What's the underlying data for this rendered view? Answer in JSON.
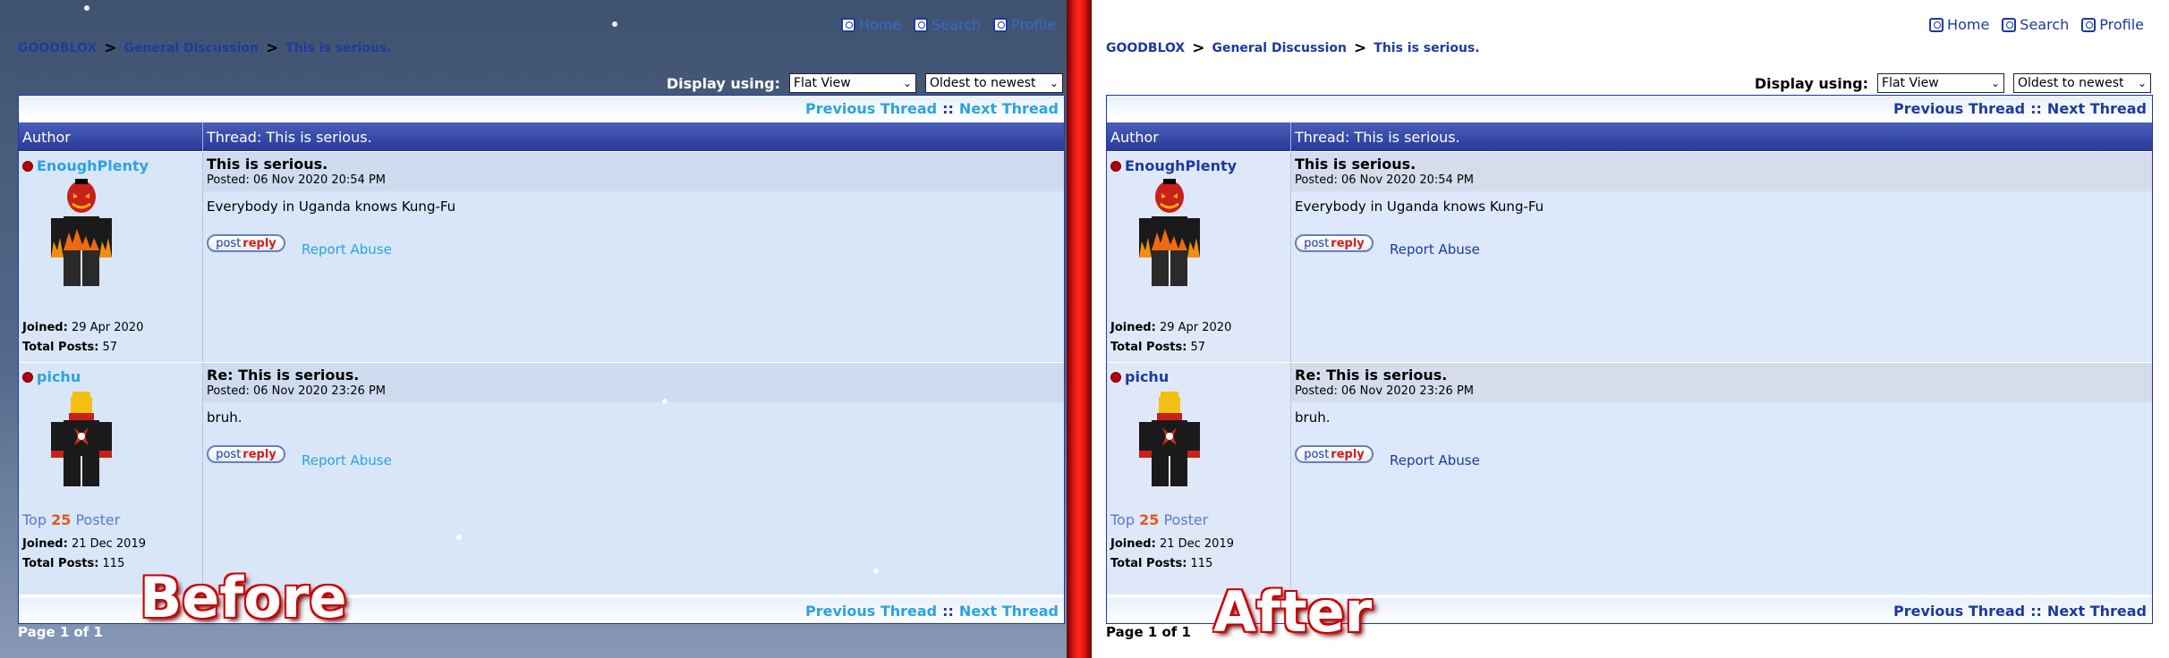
{
  "toplinks": {
    "home": "Home",
    "search": "Search",
    "profile": "Profile"
  },
  "breadcrumb": {
    "site": "GOODBLOX",
    "sep": ">",
    "forum": "General Discussion",
    "thread": "This is serious."
  },
  "controls": {
    "display_label": "Display using:",
    "display_value": "Flat View",
    "order_value": "Oldest to newest"
  },
  "nav": {
    "prev": "Previous Thread",
    "sep": "::",
    "next": "Next Thread"
  },
  "header": {
    "author": "Author",
    "thread": "Thread: This is serious."
  },
  "posts": [
    {
      "username": "EnoughPlenty",
      "subject": "This is serious.",
      "posted": "Posted: 06 Nov 2020 20:54 PM",
      "message": "Everybody in Uganda knows Kung-Fu",
      "joined_label": "Joined:",
      "joined": "29 Apr 2020",
      "posts_label": "Total Posts:",
      "total_posts": "57",
      "rank": ""
    },
    {
      "username": "pichu",
      "subject": "Re: This is serious.",
      "posted": "Posted: 06 Nov 2020 23:26 PM",
      "message": "bruh.",
      "joined_label": "Joined:",
      "joined": "21 Dec 2019",
      "posts_label": "Total Posts:",
      "total_posts": "115",
      "rank_pre": "Top",
      "rank_num": "25",
      "rank_post": "Poster"
    }
  ],
  "reply": {
    "part1": "post",
    "part2": "reply"
  },
  "report": "Report Abuse",
  "pageinfo": "Page 1 of 1",
  "labels": {
    "before": "Before",
    "after": "After"
  },
  "colors": {
    "accent_blue": "#1b3aa0",
    "header_blue": "#27399a",
    "before_link": "#2aa3e0",
    "divider_red": "#e01818"
  }
}
